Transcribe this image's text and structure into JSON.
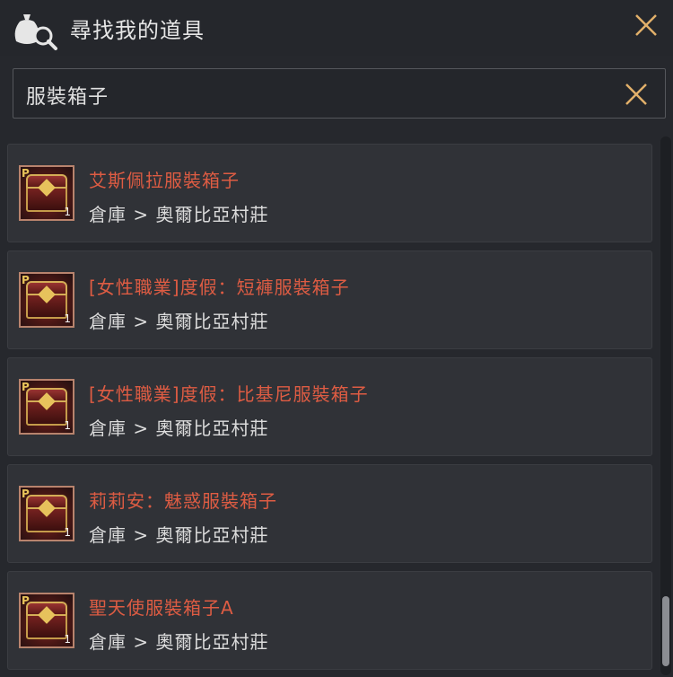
{
  "window": {
    "title": "尋找我的道具",
    "title_icon": "money-bag-search-icon",
    "close_icon": "close-icon"
  },
  "search": {
    "value": "服裝箱子",
    "clear_icon": "clear-icon"
  },
  "results": [
    {
      "name": "艾斯佩拉服裝箱子",
      "location": "倉庫 > 奧爾比亞村莊",
      "badge": "P",
      "quantity": "1"
    },
    {
      "name": "[女性職業]度假：短褲服裝箱子",
      "location": "倉庫 > 奧爾比亞村莊",
      "badge": "P",
      "quantity": "1"
    },
    {
      "name": "[女性職業]度假：比基尼服裝箱子",
      "location": "倉庫 > 奧爾比亞村莊",
      "badge": "P",
      "quantity": "1"
    },
    {
      "name": "莉莉安：魅惑服裝箱子",
      "location": "倉庫 > 奧爾比亞村莊",
      "badge": "P",
      "quantity": "1"
    },
    {
      "name": "聖天使服裝箱子A",
      "location": "倉庫 > 奧爾比亞村莊",
      "badge": "P",
      "quantity": "1"
    }
  ],
  "colors": {
    "item_name": "#de5c43",
    "location": "#dcdcdc",
    "background": "#26282d"
  }
}
